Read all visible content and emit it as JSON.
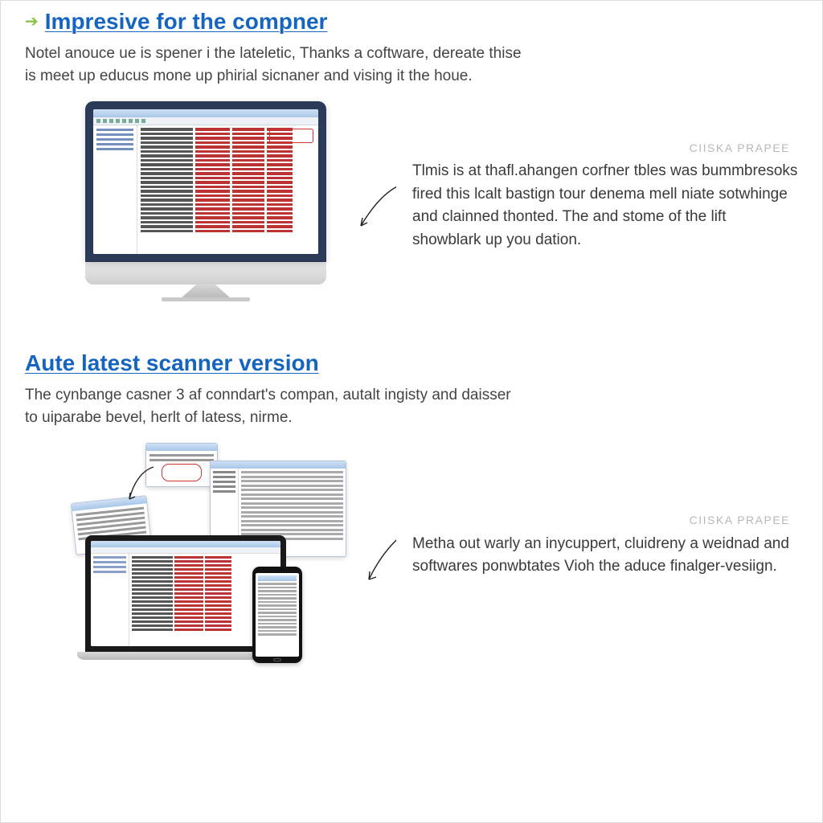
{
  "watermark": "CIISKA PRAPEE",
  "sections": [
    {
      "heading": "Impresive for the compner",
      "intro": "Notel anouce ue is spener i the lateletic, Thanks a coftware, dereate thise is meet up educus mone up phirial sicnaner and vising it the houe.",
      "desc": "Tlmis is at thafl.ahangen corfner tbles was bummbresoks fired this lcalt bastign tour denema mell niate sotwhinge and clainned thonted. The and stome of the lift showblark up you dation."
    },
    {
      "heading": "Aute latest scanner version",
      "intro": "The cynbange casner 3 af conndart's compan, autalt ingisty and daisser to uiparabe bevel, herlt of latess, nirme.",
      "desc": "Metha out warly an inycuppert, cluidreny a weidnad and softwares ponwbtates Vioh the aduce finalger-vesiign."
    }
  ]
}
